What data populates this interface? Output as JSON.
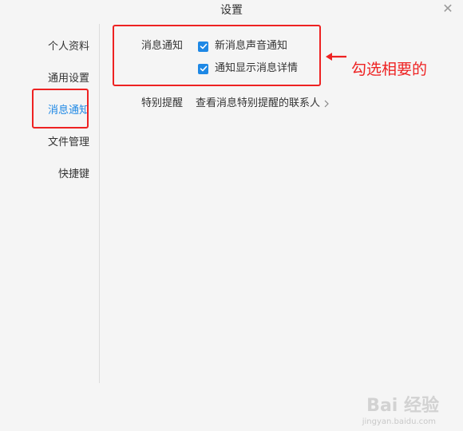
{
  "window": {
    "title": "设置"
  },
  "sidebar": {
    "items": [
      {
        "label": "个人资料"
      },
      {
        "label": "通用设置"
      },
      {
        "label": "消息通知",
        "active": true
      },
      {
        "label": "文件管理"
      },
      {
        "label": "快捷键"
      }
    ]
  },
  "notifications": {
    "section_label": "消息通知",
    "options": [
      {
        "label": "新消息声音通知",
        "checked": true
      },
      {
        "label": "通知显示消息详情",
        "checked": true
      }
    ],
    "special_label": "特别提醒",
    "special_link": "查看消息特别提醒的联系人"
  },
  "annotation": {
    "text": "勾选相要的",
    "color": "#ee2222"
  },
  "colors": {
    "accent": "#1e88e5",
    "background": "#f5f5f5"
  },
  "watermark": {
    "text": "Bai 经验",
    "url": "jingyan.baidu.com"
  }
}
